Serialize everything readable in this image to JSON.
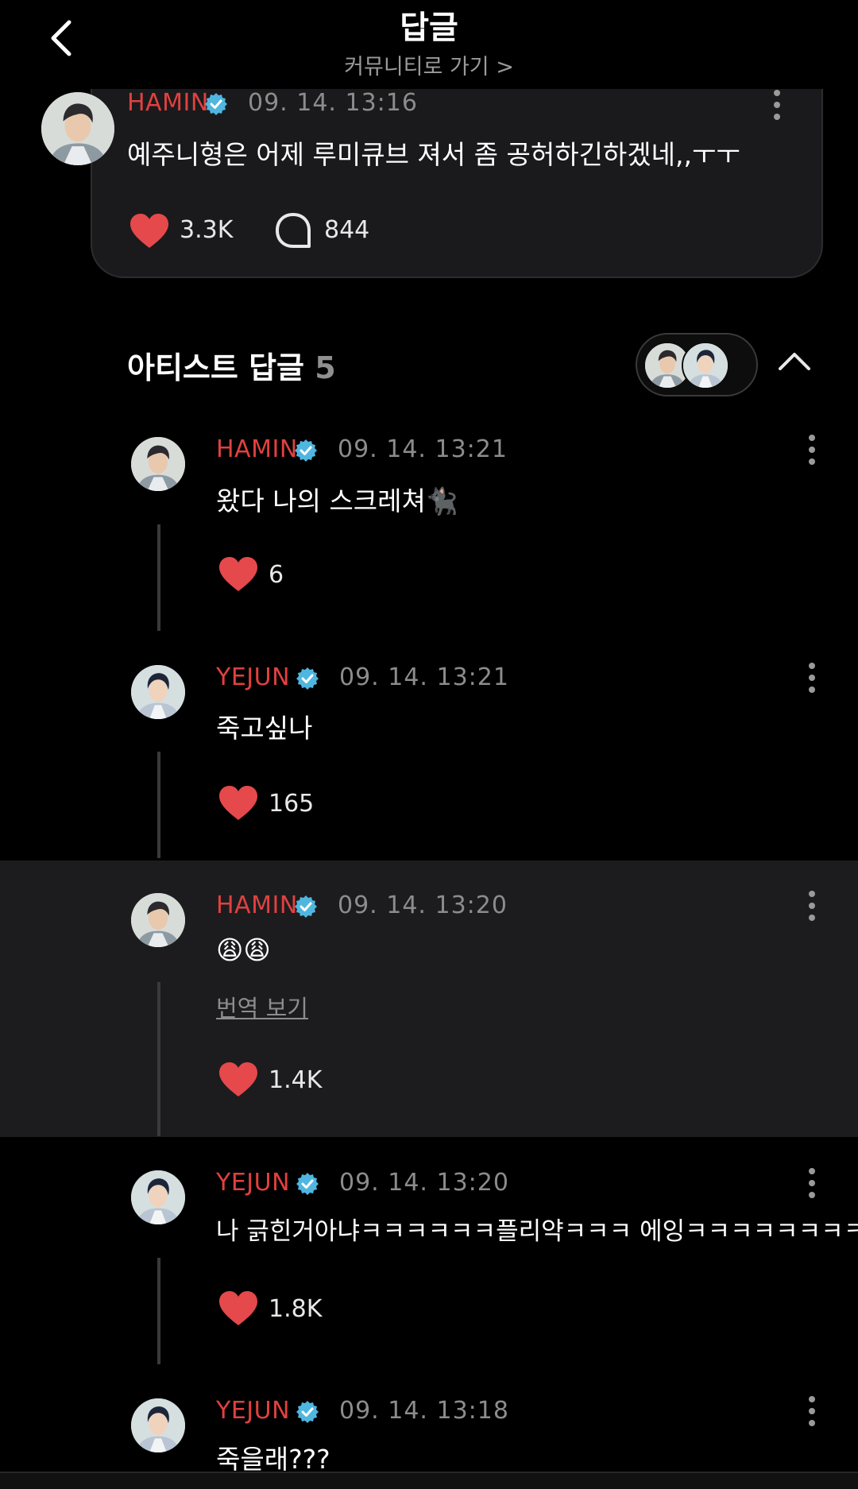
{
  "header": {
    "title": "답글",
    "subtitle": "커뮤니티로 가기 >"
  },
  "post": {
    "author": "HAMIN",
    "time": "09. 14. 13:16",
    "text": "예주니형은 어제 루미큐브 져서 좀 공허하긴하겠네,,ㅜㅜ",
    "likes": "3.3K",
    "comments": "844"
  },
  "section": {
    "title": "아티스트 답글",
    "count": "5"
  },
  "replies": [
    {
      "author": "HAMIN",
      "time": "09. 14. 13:21",
      "text": "왔다 나의 스크레쳐🐈‍⬛",
      "likes": "6"
    },
    {
      "author": "YEJUN",
      "time": "09. 14. 13:21",
      "text": "죽고싶나",
      "likes": "165"
    },
    {
      "author": "HAMIN",
      "time": "09. 14. 13:20",
      "text": "😩😩",
      "translate": "번역 보기",
      "likes": "1.4K"
    },
    {
      "author": "YEJUN",
      "time": "09. 14. 13:20",
      "text": "나 긁힌거아냐ㅋㅋㅋㅋㅋㅋ플리약ㅋㅋㅋ 에잉ㅋㅋㅋㅋㅋㅋㅋㅋ",
      "likes": "1.8K"
    },
    {
      "author": "YEJUN",
      "time": "09. 14. 13:18",
      "text": "죽을래???"
    }
  ],
  "colors": {
    "accent_name": "#e0413f",
    "heart": "#e5494b",
    "verified": "#4fb6e0",
    "background": "#000000"
  },
  "icons": [
    "back-arrow-icon",
    "verified-icon",
    "more-vertical-icon",
    "heart-icon",
    "comment-icon",
    "chevron-up-icon"
  ]
}
